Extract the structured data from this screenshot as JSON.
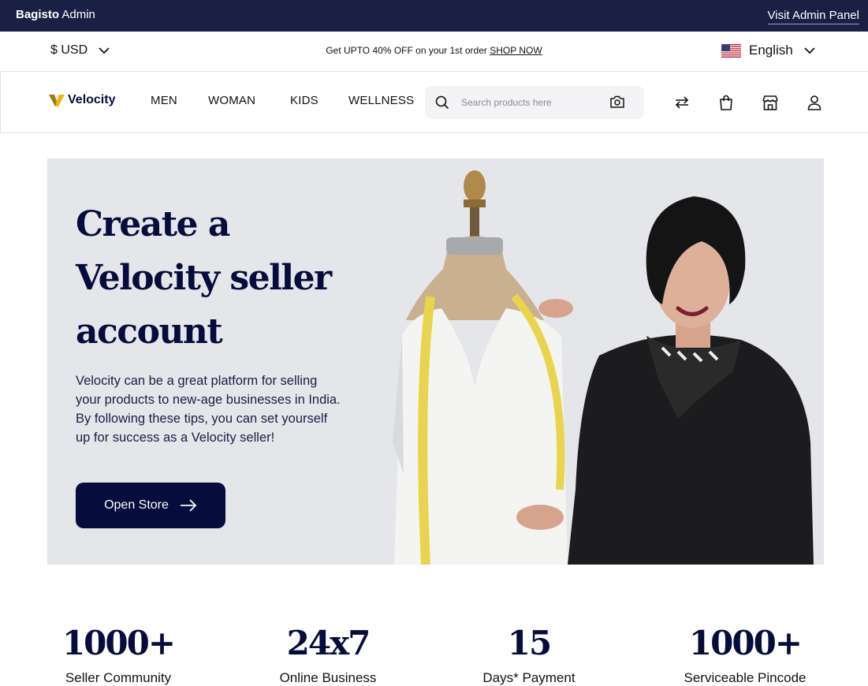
{
  "admin_bar": {
    "brand_bold": "Bagisto",
    "brand_rest": " Admin",
    "link": "Visit Admin Panel"
  },
  "promo_bar": {
    "currency": "$ USD",
    "promo_text": "Get UPTO 40% OFF on your 1st order ",
    "shop_now": "SHOP NOW",
    "language": "English",
    "flag_icon": "us-flag-icon"
  },
  "header": {
    "logo_text": "Velocity",
    "nav": [
      "MEN",
      "WOMAN",
      "KIDS",
      "WELLNESS"
    ],
    "search_placeholder": "Search products here",
    "icons": [
      "search-icon",
      "camera-icon",
      "compare-arrows-icon",
      "shopping-bag-icon",
      "store-icon",
      "user-icon"
    ]
  },
  "hero": {
    "title": "Create a Velocity seller account",
    "description": "Velocity can be a great platform for selling your products to new-age businesses in India. By following these tips, you can set yourself up for success as a Velocity seller!",
    "button": "Open Store"
  },
  "stats": [
    {
      "number": "1000+",
      "label": "Seller Community"
    },
    {
      "number": "24x7",
      "label": "Online Business"
    },
    {
      "number": "15",
      "label": "Days* Payment"
    },
    {
      "number": "1000+",
      "label": "Serviceable Pincode"
    }
  ],
  "colors": {
    "navy": "#060c3b",
    "admin_bar": "#1a1f44",
    "hero_bg": "#e5e6ea",
    "logo_accent": "#f5b400"
  }
}
